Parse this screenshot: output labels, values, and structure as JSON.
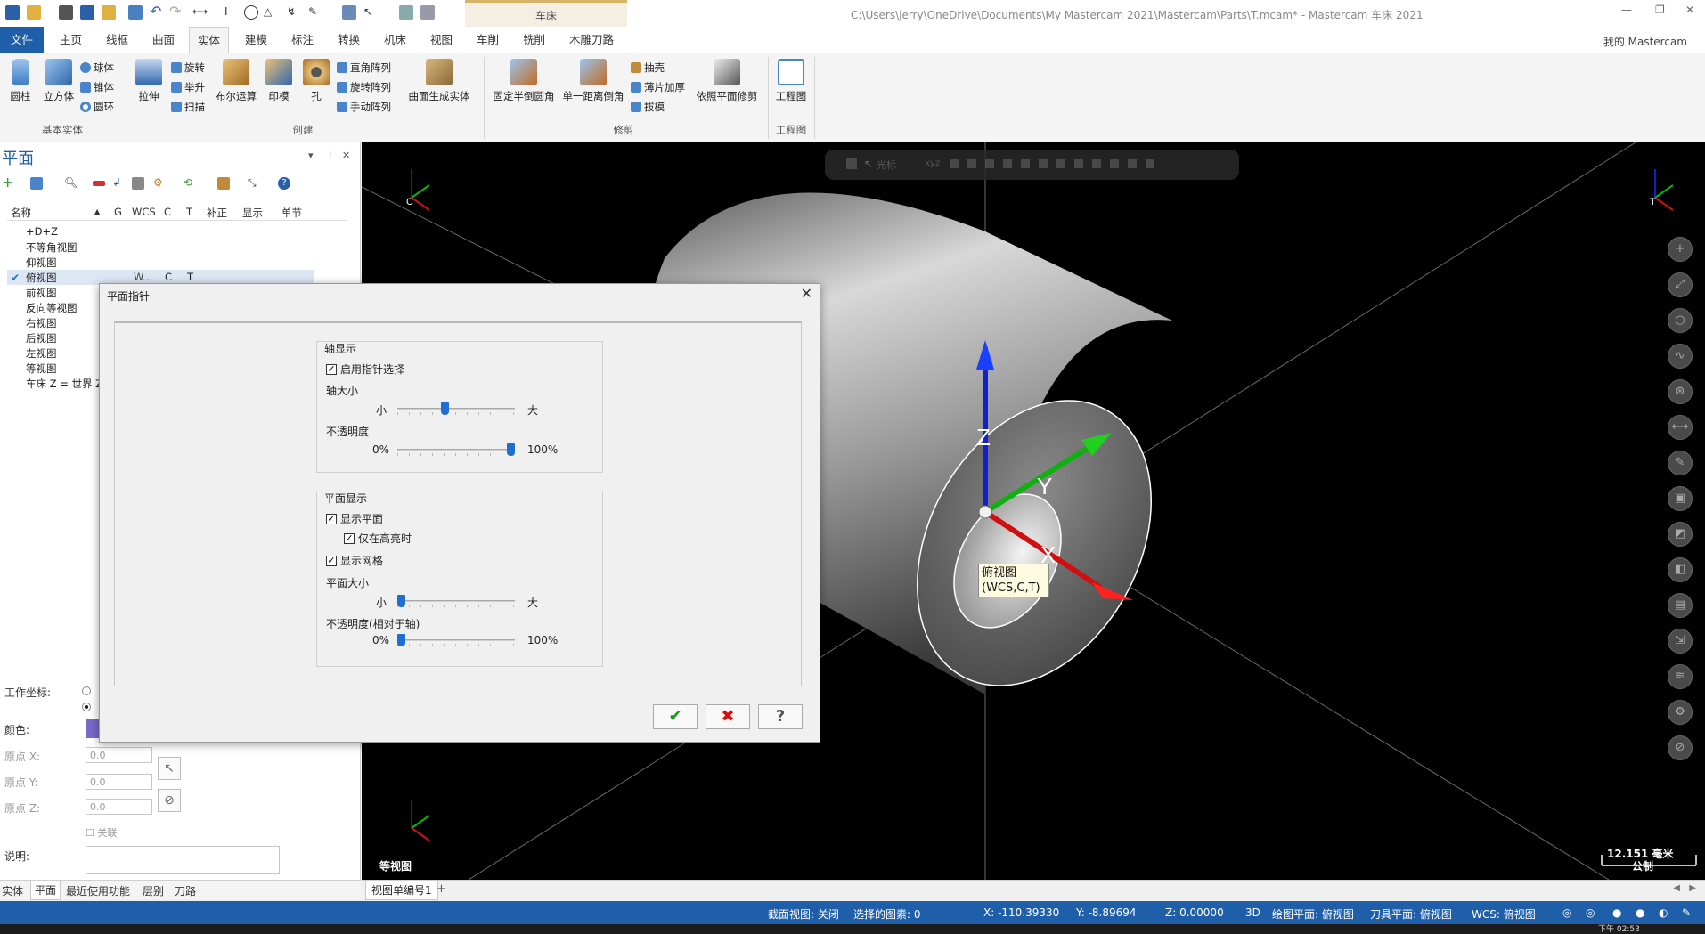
{
  "window": {
    "title": "C:\\Users\\jerry\\OneDrive\\Documents\\My Mastercam 2021\\Mastercam\\Parts\\T.mcam* - Mastercam 车床 2021",
    "context_tab": "车床",
    "my_mastercam": "我的 Mastercam"
  },
  "menu": {
    "tabs": [
      "文件",
      "主页",
      "线框",
      "曲面",
      "实体",
      "建模",
      "标注",
      "转换",
      "机床",
      "视图",
      "车削",
      "铣削",
      "木雕刀路"
    ],
    "active": "实体"
  },
  "ribbon": {
    "groups": [
      {
        "label": "基本实体",
        "big": [
          "圆柱",
          "立方体"
        ],
        "small": [
          "球体",
          "锥体",
          "圆环"
        ]
      },
      {
        "label": "创建",
        "big": [
          "拉伸",
          "布尔运算",
          "印模",
          "孔",
          "曲面生成实体"
        ],
        "small": [
          "旋转",
          "举升",
          "扫描",
          "直角阵列",
          "旋转阵列",
          "手动阵列"
        ]
      },
      {
        "label": "修剪",
        "big": [
          "固定半倒圆角",
          "单一距离倒角",
          "依照平面修剪"
        ],
        "small": [
          "抽壳",
          "薄片加厚",
          "拔模"
        ]
      },
      {
        "label": "工程图",
        "big": [
          "工程图"
        ],
        "small": []
      }
    ]
  },
  "panel": {
    "title": "平面",
    "columns": [
      "名称",
      "G",
      "WCS",
      "C",
      "T",
      "补正",
      "显示",
      "单节"
    ],
    "planes": [
      {
        "name": "+D+Z",
        "wcs": "",
        "c": "",
        "t": "",
        "checked": false
      },
      {
        "name": "不等角视图",
        "wcs": "",
        "c": "",
        "t": "",
        "checked": false
      },
      {
        "name": "仰视图",
        "wcs": "",
        "c": "",
        "t": "",
        "checked": false
      },
      {
        "name": "俯视图",
        "wcs": "W...",
        "c": "C",
        "t": "T",
        "checked": true
      },
      {
        "name": "前视图",
        "wcs": "",
        "c": "",
        "t": "",
        "checked": false
      },
      {
        "name": "反向等视图",
        "wcs": "",
        "c": "",
        "t": "",
        "checked": false
      },
      {
        "name": "右视图",
        "wcs": "",
        "c": "",
        "t": "",
        "checked": false
      },
      {
        "name": "后视图",
        "wcs": "",
        "c": "",
        "t": "",
        "checked": false
      },
      {
        "name": "左视图",
        "wcs": "",
        "c": "",
        "t": "",
        "checked": false
      },
      {
        "name": "等视图",
        "wcs": "",
        "c": "",
        "t": "",
        "checked": false
      },
      {
        "name": "车床 Z = 世界 Z",
        "wcs": "",
        "c": "",
        "t": "",
        "checked": false
      }
    ],
    "props": {
      "work_coord": "工作坐标:",
      "color": "颜色:",
      "origin_x": "原点 X:",
      "origin_y": "原点 Y:",
      "origin_z": "原点 Z:",
      "origin_x_val": "0.0",
      "origin_y_val": "0.0",
      "origin_z_val": "0.0",
      "assoc": "关联",
      "desc": "说明:"
    },
    "tabs": [
      "实体",
      "平面",
      "最近使用功能",
      "层别",
      "刀路"
    ],
    "active_tab": "平面"
  },
  "dialog": {
    "title": "平面指针",
    "axis_group": "轴显示",
    "enable_pointer": "启用指针选择",
    "axis_size": "轴大小",
    "small": "小",
    "large": "大",
    "opacity": "不透明度",
    "pct0": "0%",
    "pct100": "100%",
    "plane_group": "平面显示",
    "show_plane": "显示平面",
    "only_highlight": "仅在高亮时",
    "show_grid": "显示网格",
    "plane_size": "平面大小",
    "opacity_rel": "不透明度(相对于轴)",
    "axis_size_value": 0.4,
    "opacity_value": 1.0,
    "plane_size_value": 0.0,
    "opacity_rel_value": 0.0,
    "ok": "✔",
    "cancel": "✖",
    "help": "?"
  },
  "viewport": {
    "toolbar_label": "光标",
    "view_name": "等视图",
    "tooltip_line1": "俯视图",
    "tooltip_line2": "(WCS,C,T)",
    "scale": "12.151 毫米",
    "unit": "公制",
    "axis_x": "X",
    "axis_y": "Y",
    "axis_z": "Z",
    "corner_c": "C",
    "corner_t": "T",
    "view_tab": "视图单编号1"
  },
  "status": {
    "section": "截面视图: 关闭",
    "selected": "选择的图素: 0",
    "x": "X: -110.39330",
    "y": "Y: -8.89694",
    "z": "Z: 0.00000",
    "mode": "3D",
    "draw_plane": "绘图平面: 俯视图",
    "tool_plane": "刀具平面: 俯视图",
    "wcs": "WCS: 俯视图",
    "time": "下午 02:53"
  },
  "colors": {
    "brand_blue": "#1f5ea8",
    "axis_x": "#d01010",
    "axis_y": "#10b010",
    "axis_z": "#1020d0",
    "tooltip_bg": "#fffbe0"
  }
}
